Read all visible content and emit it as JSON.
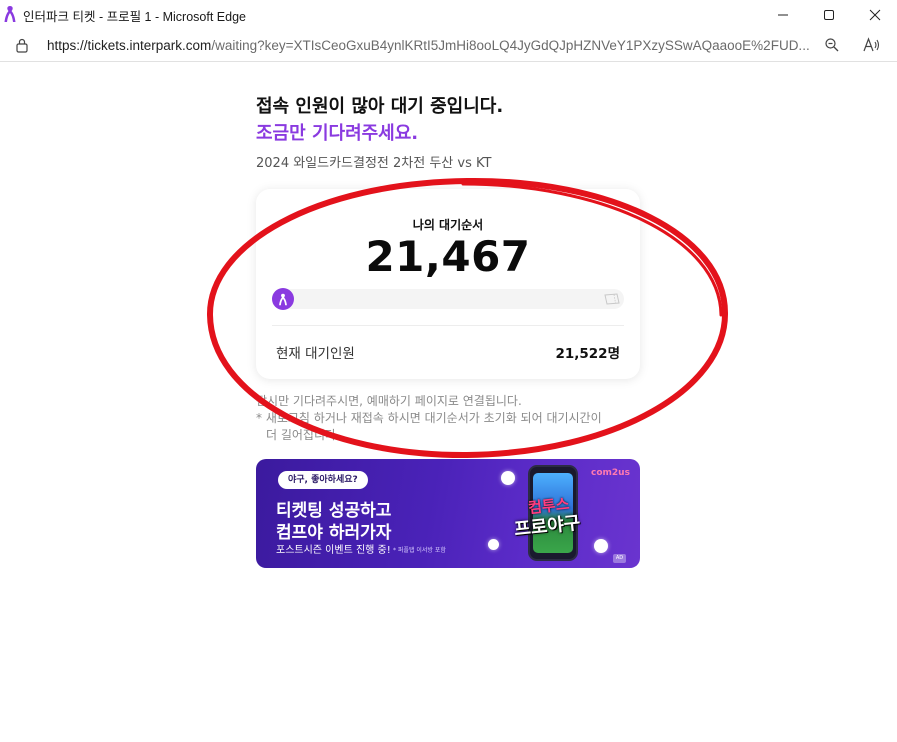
{
  "window": {
    "title": "인터파크 티켓 - 프로필 1 - Microsoft Edge",
    "controls": [
      "minimize",
      "maximize",
      "close"
    ]
  },
  "address_bar": {
    "url_host": "https://tickets.interpark.com",
    "url_rest": "/waiting?key=XTIsCeoGxuB4ynlKRtI5JmHi8ooLQ4JyGdQJpHZNVeY1PXzySSwAQaaooE%2FUD...",
    "icons": [
      "lock-icon",
      "zoom-out-icon",
      "read-aloud-icon"
    ]
  },
  "waiting": {
    "heading_line1": "접속 인원이 많아 대기 중입니다.",
    "heading_line2": "조금만 기다려주세요.",
    "event_name": "2024 와일드카드결정전 2차전 두산 vs KT",
    "queue_label": "나의 대기순서",
    "queue_number": "21,467",
    "progress_fraction": 0.0,
    "total_label": "현재 대기인원",
    "total_value": "21,522명",
    "notice_line1": "잠시만 기다려주시면, 예매하기 페이지로 연결됩니다.",
    "notice_line2": "* 새로고침 하거나 재접속 하시면 대기순서가 초기화 되어 대기시간이",
    "notice_line3": "더 길어집니다."
  },
  "banner": {
    "bubble": "야구, 좋아하세요?",
    "line1": "티켓팅 성공하고",
    "line2": "컴프야 하러가자",
    "sub": "포스트시즌 이벤트 진행 중!",
    "fine_print": "* 퍼플탭 이서방 포함",
    "brand": "com2us",
    "logo_line1": "컴투스",
    "logo_line2": "프로야구",
    "ad_badge": "AD"
  },
  "colors": {
    "accent_purple": "#8a3ae0",
    "annotation_red": "#e3121b"
  }
}
